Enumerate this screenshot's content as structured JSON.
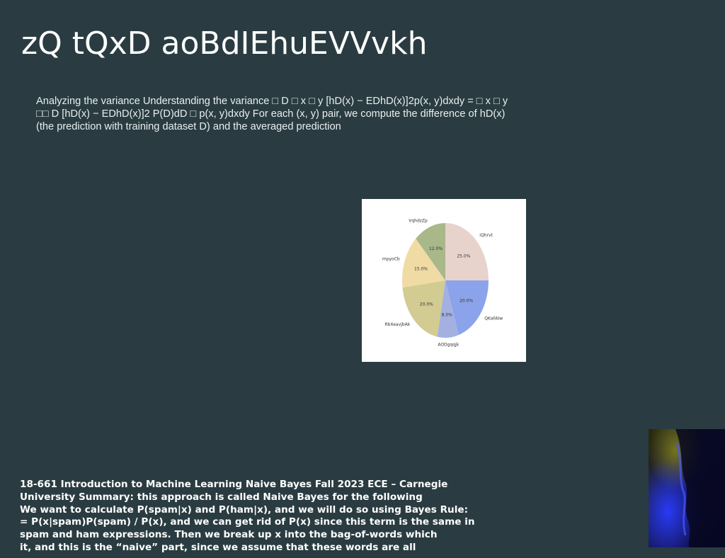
{
  "slide": {
    "title": "zQ tQxD aoBdIEhuEVVvkh",
    "body": "Analyzing the variance Understanding the variance □ D □ x □ y [hD(x) − EDhD(x)]2p(x, y)dxdy = □ x □ y □□ D [hD(x) − EDhD(x)]2 P(D)dD □ p(x, y)dxdy For each (x, y) pair, we compute the difference of hD(x) (the prediction with training dataset D) and the averaged prediction",
    "footer_lines": [
      "18-661 Introduction to Machine Learning Naive Bayes Fall 2023 ECE – Carnegie",
      "University Summary: this approach is called Naive Bayes for the following",
      "We want to calculate P(spam|x) and P(ham|x), and we will do so using Bayes Rule:",
      "= P(x|spam)P(spam) / P(x), and we can get rid of P(x) since this term is the same in",
      "spam and ham expressions. Then we break up x into the bag-of-words which",
      "it, and this is the “naive” part, since we assume that these words are all"
    ]
  },
  "chart_data": {
    "type": "pie",
    "categories": [
      "iQhrvt",
      "QKaFAIw",
      "AODgqqjk",
      "RbXeavjbAk",
      "mpyoCb",
      "VqhdzZp"
    ],
    "values": [
      25.0,
      20.0,
      8.0,
      20.0,
      15.0,
      12.0
    ],
    "value_labels": [
      "25.0%",
      "20.0%",
      "8.0%",
      "20.0%",
      "15.0%",
      "12.0%"
    ],
    "colors": [
      "#e8d3cc",
      "#8aa3ea",
      "#a3b0e0",
      "#d2cc92",
      "#f0dba4",
      "#a8b889"
    ],
    "start_angle_deg": 90,
    "direction": "clockwise"
  }
}
